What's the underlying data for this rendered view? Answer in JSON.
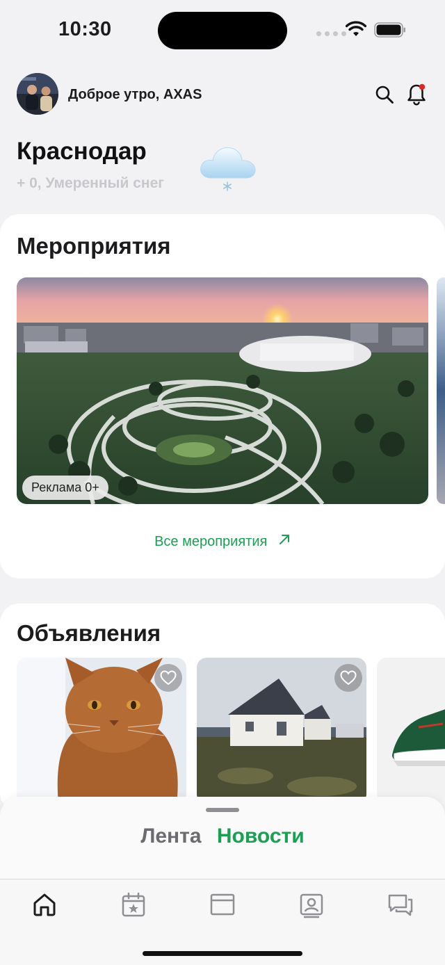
{
  "status_bar": {
    "time": "10:30"
  },
  "header": {
    "greeting": "Доброе утро, AXAS"
  },
  "weather": {
    "city": "Краснодар",
    "summary": "+ 0, Умеренный снег"
  },
  "events": {
    "title": "Мероприятия",
    "banner_badge": "Реклама 0+",
    "all_link": "Все мероприятия"
  },
  "ads": {
    "title": "Объявления"
  },
  "sheet": {
    "tab_feed": "Лента",
    "tab_news": "Новости"
  },
  "colors": {
    "accent": "#1aa053",
    "notification_dot": "#e02424"
  }
}
